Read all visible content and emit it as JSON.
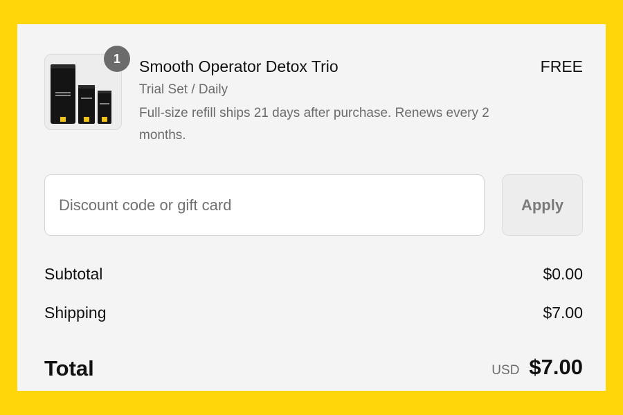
{
  "colors": {
    "background": "#FFD60A",
    "panel": "#F4F4F4",
    "badge": "#6B6B6B",
    "muted_text": "#6B6B6B"
  },
  "product": {
    "quantity": "1",
    "name": "Smooth Operator Detox Trio",
    "price": "FREE",
    "variant": "Trial Set / Daily",
    "note": "Full-size refill ships 21 days after purchase. Renews every 2 months.",
    "image_icon": "skincare-product-trio-image"
  },
  "discount": {
    "placeholder": "Discount code or gift card",
    "value": "",
    "apply_label": "Apply"
  },
  "summary": {
    "subtotal_label": "Subtotal",
    "subtotal_value": "$0.00",
    "shipping_label": "Shipping",
    "shipping_value": "$7.00",
    "total_label": "Total",
    "currency": "USD",
    "total_value": "$7.00"
  }
}
